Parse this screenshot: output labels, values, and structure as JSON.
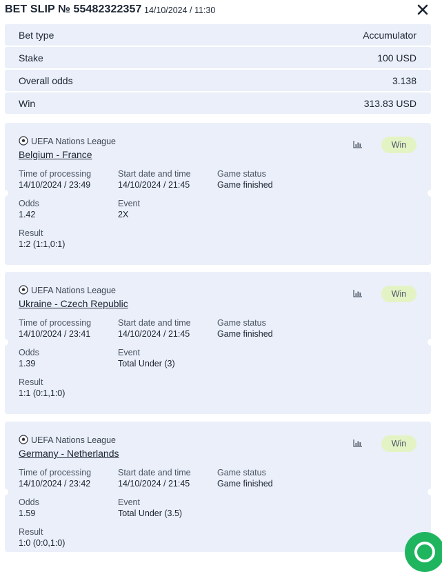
{
  "header": {
    "title": "BET SLIP № 55482322357",
    "datetime": "14/10/2024 / 11:30"
  },
  "summary": [
    {
      "label": "Bet type",
      "value": "Accumulator"
    },
    {
      "label": "Stake",
      "value": "100 USD"
    },
    {
      "label": "Overall odds",
      "value": "3.138"
    },
    {
      "label": "Win",
      "value": "313.83 USD"
    }
  ],
  "labels": {
    "time_of_processing": "Time of processing",
    "start_date": "Start date and time",
    "game_status": "Game status",
    "odds": "Odds",
    "event": "Event",
    "result": "Result"
  },
  "bets": [
    {
      "league": "UEFA Nations League",
      "match": "Belgium - France",
      "status_badge": "Win",
      "time_of_processing": "14/10/2024 / 23:49",
      "start_date": "14/10/2024 / 21:45",
      "game_status": "Game finished",
      "odds": "1.42",
      "event": "2X",
      "result": "1:2 (1:1,0:1)"
    },
    {
      "league": "UEFA Nations League",
      "match": "Ukraine - Czech Republic",
      "status_badge": "Win",
      "time_of_processing": "14/10/2024 / 23:41",
      "start_date": "14/10/2024 / 21:45",
      "game_status": "Game finished",
      "odds": "1.39",
      "event": "Total Under (3)",
      "result": "1:1 (0:1,1:0)"
    },
    {
      "league": "UEFA Nations League",
      "match": "Germany - Netherlands",
      "status_badge": "Win",
      "time_of_processing": "14/10/2024 / 23:42",
      "start_date": "14/10/2024 / 21:45",
      "game_status": "Game finished",
      "odds": "1.59",
      "event": "Total Under (3.5)",
      "result": "1:0 (0:0,1:0)"
    }
  ],
  "icons": {
    "close": "close-icon",
    "ball": "soccer-ball-icon",
    "stats": "bar-chart-icon",
    "chat": "chat-icon"
  },
  "colors": {
    "card_bg": "#eaeff9",
    "win_badge": "#e4f3c3",
    "chat_button": "#1fb55f"
  }
}
